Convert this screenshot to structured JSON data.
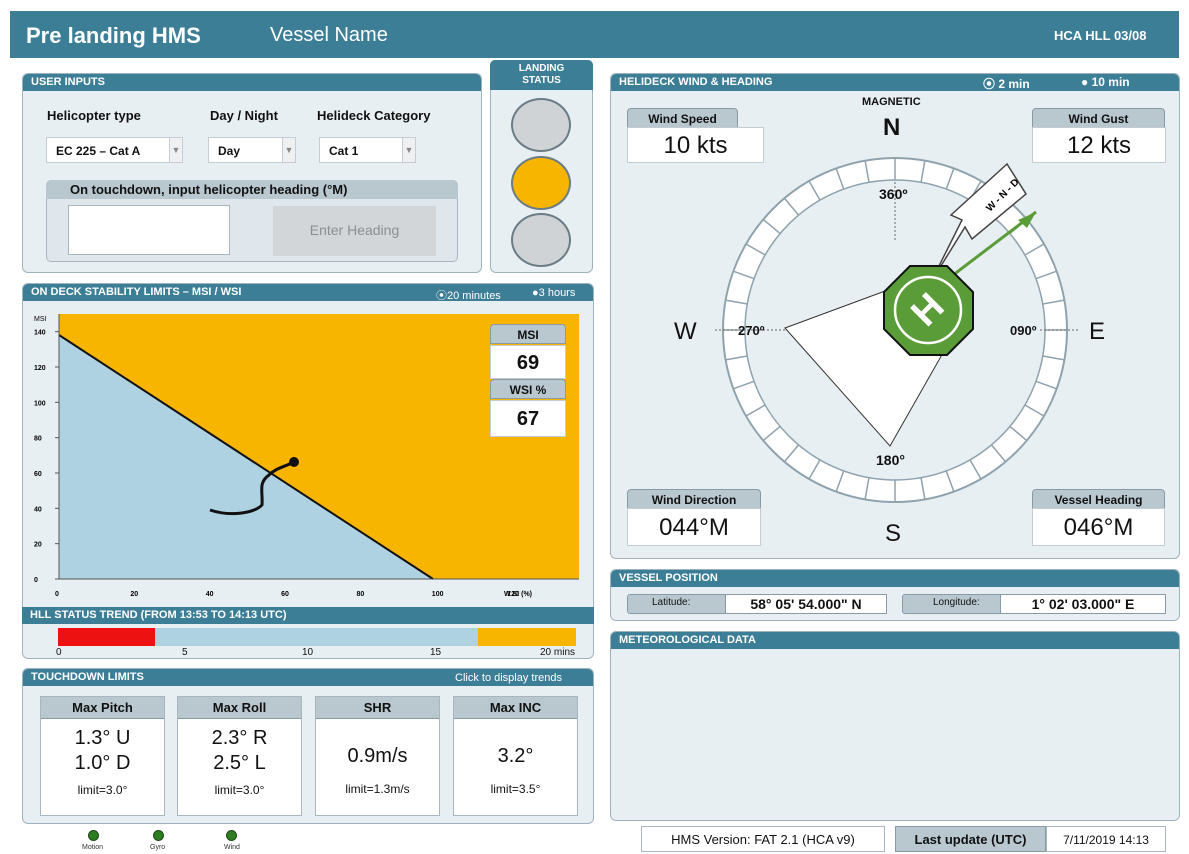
{
  "header": {
    "title": "Pre landing HMS",
    "vessel_name": "Vessel Name",
    "code": "HCA HLL 03/08"
  },
  "user_inputs": {
    "title": "USER INPUTS",
    "helicopter_type_label": "Helicopter type",
    "helicopter_type_value": "EC 225 – Cat A",
    "day_night_label": "Day / Night",
    "day_night_value": "Day",
    "category_label": "Helideck Category",
    "category_value": "Cat 1",
    "heading_prompt": "On touchdown, input helicopter heading (°M)",
    "heading_value": "",
    "enter_heading_label": "Enter Heading"
  },
  "landing_status": {
    "title_line1": "LANDING",
    "title_line2": "STATUS",
    "lights": [
      "grey",
      "amber",
      "grey"
    ],
    "colors": {
      "grey": "#d0d3d6",
      "amber": "#f7b500"
    }
  },
  "stability": {
    "title": "ON DECK STABILITY LIMITS – MSI / WSI",
    "option_20min": "20 minutes",
    "option_3h": "3 hours",
    "msi_label": "MSI",
    "msi_value": "69",
    "wsi_label": "WSI %",
    "wsi_value": "67",
    "y_axis_label": "MSI",
    "x_axis_label": "W SI (%)",
    "y_ticks": [
      "140",
      "120",
      "100",
      "80",
      "60",
      "40",
      "20",
      "0"
    ],
    "x_ticks": [
      "0",
      "20",
      "40",
      "60",
      "80",
      "100",
      "120"
    ]
  },
  "trend": {
    "title": "HLL STATUS TREND  (FROM 13:53 TO 14:13 UTC)",
    "ticks": [
      "0",
      "5",
      "10",
      "15",
      "20 mins"
    ],
    "colors": {
      "red": "#ee1111",
      "amber": "#f7b500",
      "base": "#aed2e1"
    }
  },
  "touchdown": {
    "title": "TOUCHDOWN LIMITS",
    "trends_link": "Click to display trends",
    "cols": [
      {
        "header": "Max Pitch",
        "line1": "1.3° U",
        "line2": "1.0° D",
        "limit": "limit=3.0°"
      },
      {
        "header": "Max Roll",
        "line1": "2.3° R",
        "line2": "2.5° L",
        "limit": "limit=3.0°"
      },
      {
        "header": "SHR",
        "line1": "0.9m/s",
        "limit": "limit=1.3m/s"
      },
      {
        "header": "Max INC",
        "line1": "3.2°",
        "limit": "limit=3.5°"
      }
    ]
  },
  "indicators": [
    "Motion",
    "Gyro",
    "Wind"
  ],
  "wind": {
    "title": "HELIDECK WIND & HEADING",
    "option_2min": "2 min",
    "option_10min": "10 min",
    "magnetic": "MAGNETIC",
    "speed_label": "Wind Speed",
    "speed_value": "10 kts",
    "gust_label": "Wind Gust",
    "gust_value": "12 kts",
    "direction_label": "Wind Direction",
    "direction_value": "044°M",
    "heading_label": "Vessel Heading",
    "heading_value": "046°M",
    "n": "N",
    "s": "S",
    "e": "E",
    "w": "W",
    "deg_360": "360º",
    "deg_270": "270º",
    "deg_090": "090º",
    "deg_180": "180°",
    "arrow_text": "W - N - D",
    "helipad_letter": "H"
  },
  "position": {
    "title": "VESSEL POSITION",
    "lat_label": "Latitude:",
    "lat_value": "58° 05' 54.000\" N",
    "lon_label": "Longitude:",
    "lon_value": "1° 02' 03.000\" E"
  },
  "met": {
    "title": "METEOROLOGICAL DATA"
  },
  "footer": {
    "version": "HMS Version: FAT 2.1 (HCA v9)",
    "last_update_label": "Last update (UTC)",
    "last_update_value": "7/11/2019 14:13"
  }
}
